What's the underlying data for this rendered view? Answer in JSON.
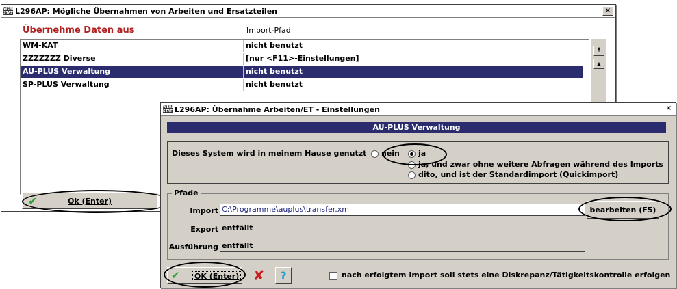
{
  "back_window": {
    "title": "L296AP: Mögliche Übernahmen von Arbeiten und Ersatzteilen",
    "close": "×",
    "header_col1": "Übernehme Daten aus",
    "header_col2": "Import-Pfad",
    "rows": [
      {
        "name": "WM-KAT",
        "path": "nicht benutzt"
      },
      {
        "name": "ZZZZZZZ Diverse",
        "path": "[nur <F11>-Einstellungen]"
      },
      {
        "name": "AU-PLUS Verwaltung",
        "path": "nicht benutzt"
      },
      {
        "name": "SP-PLUS Verwaltung",
        "path": "nicht benutzt"
      }
    ],
    "selected_row": 2,
    "ok_label": "Ok (Enter)",
    "scroll_top_icon": "⇞",
    "scroll_up_icon": "▲"
  },
  "front_window": {
    "title": "L296AP: Übernahme Arbeiten/ET - Einstellungen",
    "close": "×",
    "banner": "AU-PLUS Verwaltung",
    "usage_label": "Dieses System wird in meinem Hause genutzt",
    "opt_nein": "nein",
    "opt_ja": "ja",
    "opt_ja_ohne": "ja, und zwar ohne weitere Abfragen während des Imports",
    "opt_dito": "dito, und ist der Standardimport (Quickimport)",
    "selected_option": "ja",
    "paths_group": "Pfade",
    "import_label": "Import",
    "import_value": "C:\\Programme\\auplus\\transfer.xml",
    "edit_button": "bearbeiten (F5)",
    "export_label": "Export",
    "export_value": "entfällt",
    "exec_label": "Ausführung",
    "exec_value": "entfällt",
    "ok_label": "OK (Enter)",
    "checkbox_label": "nach erfolgtem Import soll stets eine Diskrepanz/Tätigkeitskontrolle erfolgen",
    "checkbox_checked": false,
    "help_glyph": "?",
    "cancel_glyph": "✘",
    "ok_glyph": "✔"
  },
  "colors": {
    "title_accent": "#b22222",
    "selection": "#2a2c6e",
    "banner": "#2a2c6e",
    "ok_green": "#2e9e2e",
    "cancel_red": "#cc1a1a",
    "help_cyan": "#1fa0c8"
  }
}
